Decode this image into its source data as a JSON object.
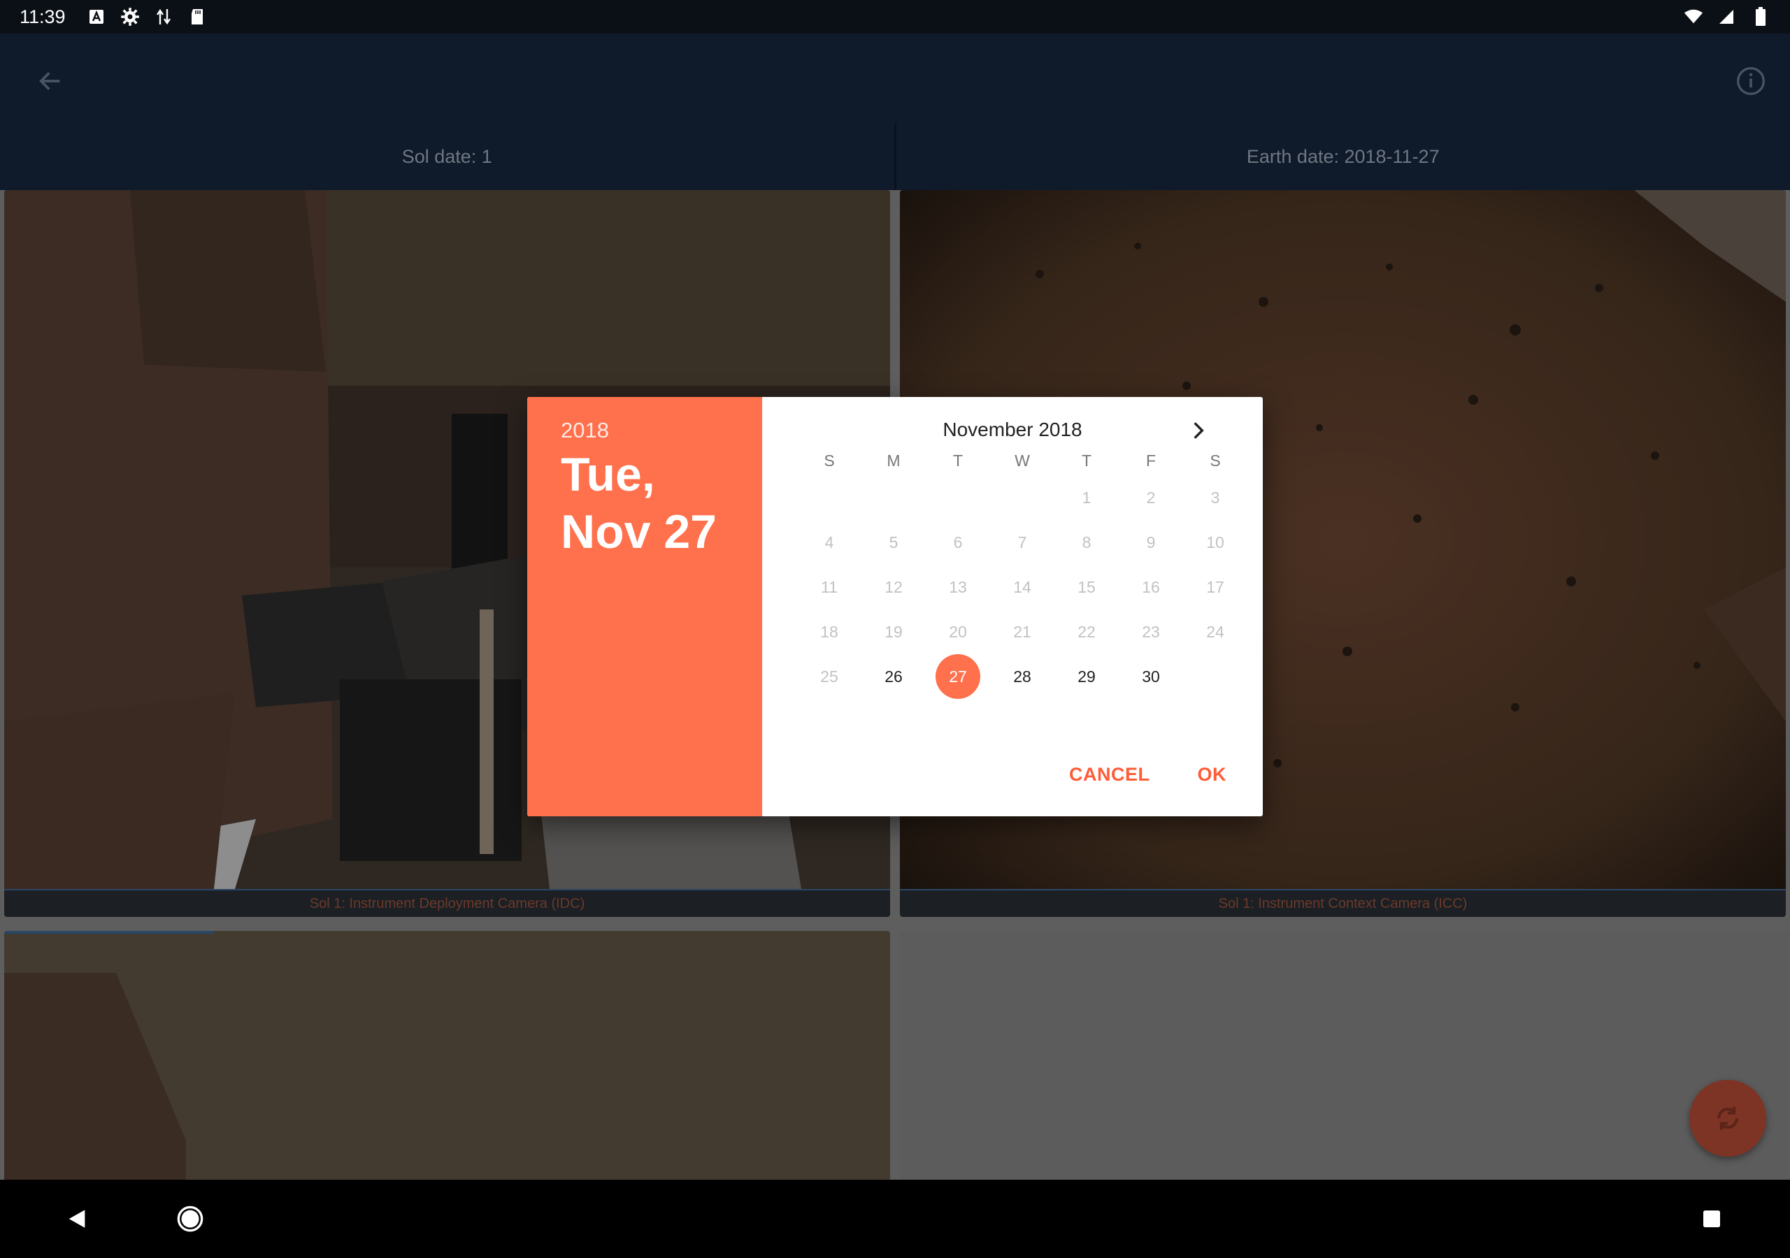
{
  "status_bar": {
    "time": "11:39"
  },
  "app_bar": {
    "sol_date": "Sol date: 1",
    "earth_date": "Earth date: 2018-11-27"
  },
  "photos": [
    {
      "caption": "Sol 1: Instrument Deployment Camera (IDC)"
    },
    {
      "caption": "Sol 1: Instrument Context Camera (ICC)"
    },
    {
      "caption": ""
    }
  ],
  "dialog": {
    "year": "2018",
    "date_line1": "Tue,",
    "date_line2": "Nov 27",
    "month_title": "November 2018",
    "weekdays": [
      "S",
      "M",
      "T",
      "W",
      "T",
      "F",
      "S"
    ],
    "days": [
      "",
      "",
      "",
      "",
      "1",
      "2",
      "3",
      "4",
      "5",
      "6",
      "7",
      "8",
      "9",
      "10",
      "11",
      "12",
      "13",
      "14",
      "15",
      "16",
      "17",
      "18",
      "19",
      "20",
      "21",
      "22",
      "23",
      "24",
      "25",
      "26",
      "27",
      "28",
      "29",
      "30",
      ""
    ],
    "selected_day": "27",
    "enabled_days": [
      "26",
      "27",
      "28",
      "29",
      "30"
    ],
    "cancel_label": "CANCEL",
    "ok_label": "OK"
  },
  "colors": {
    "accent": "#ff704c",
    "app_bar": "#0f1a2a"
  }
}
